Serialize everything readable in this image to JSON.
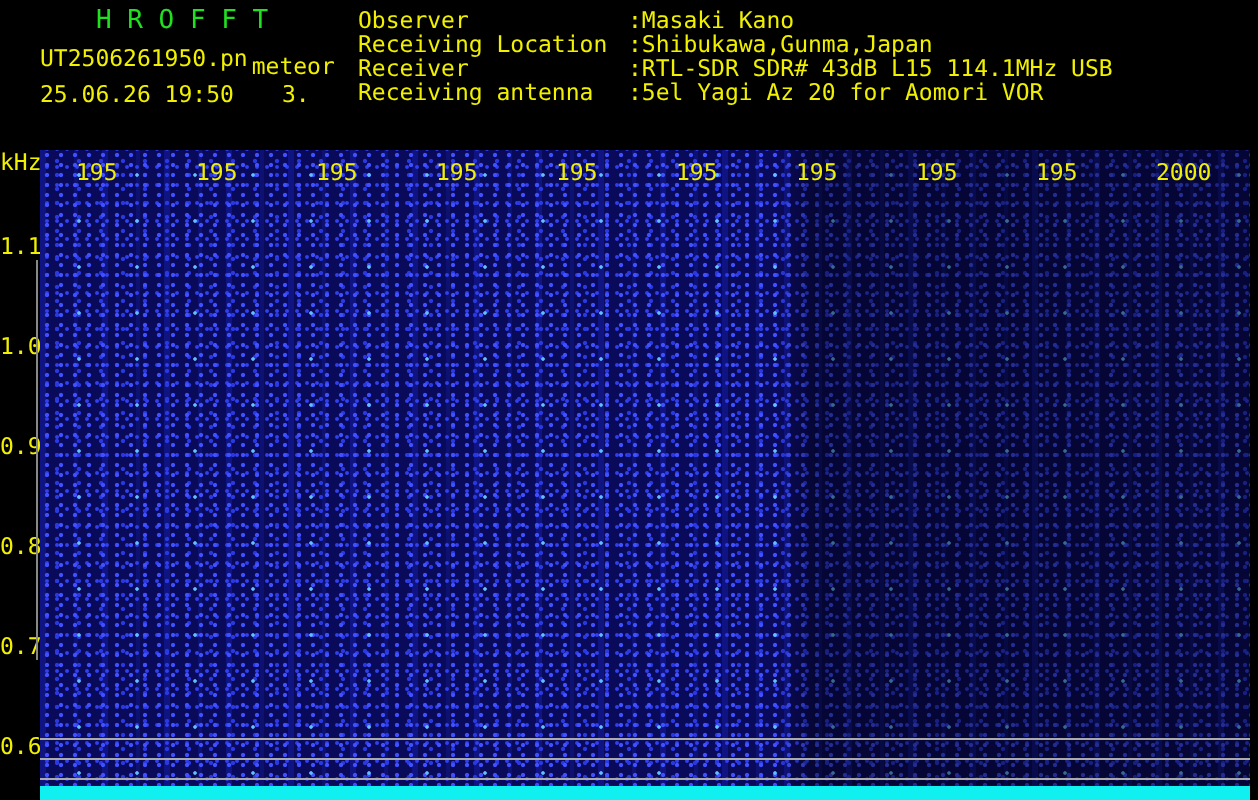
{
  "app_title": "H R O F F T",
  "file_name": "UT2506261950.pn",
  "mode": "meteor",
  "timestamp": "25.06.26 19:50",
  "count": "3.",
  "info": [
    {
      "label": "Observer",
      "value": ":Masaki Kano"
    },
    {
      "label": "Receiving Location",
      "value": ":Shibukawa,Gunma,Japan"
    },
    {
      "label": "Receiver",
      "value": ":RTL-SDR SDR# 43dB L15 114.1MHz USB"
    },
    {
      "label": "Receiving antenna",
      "value": ":5el Yagi Az 20 for Aomori VOR"
    }
  ],
  "spectrogram": {
    "unit": "kHz",
    "time_labels": [
      "195",
      "195",
      "195",
      "195",
      "195",
      "195",
      "195",
      "195",
      "195",
      "2000"
    ],
    "freq_labels": [
      "1.1",
      "1.0",
      "0.9",
      "0.8",
      "0.7",
      "0.6"
    ]
  }
}
